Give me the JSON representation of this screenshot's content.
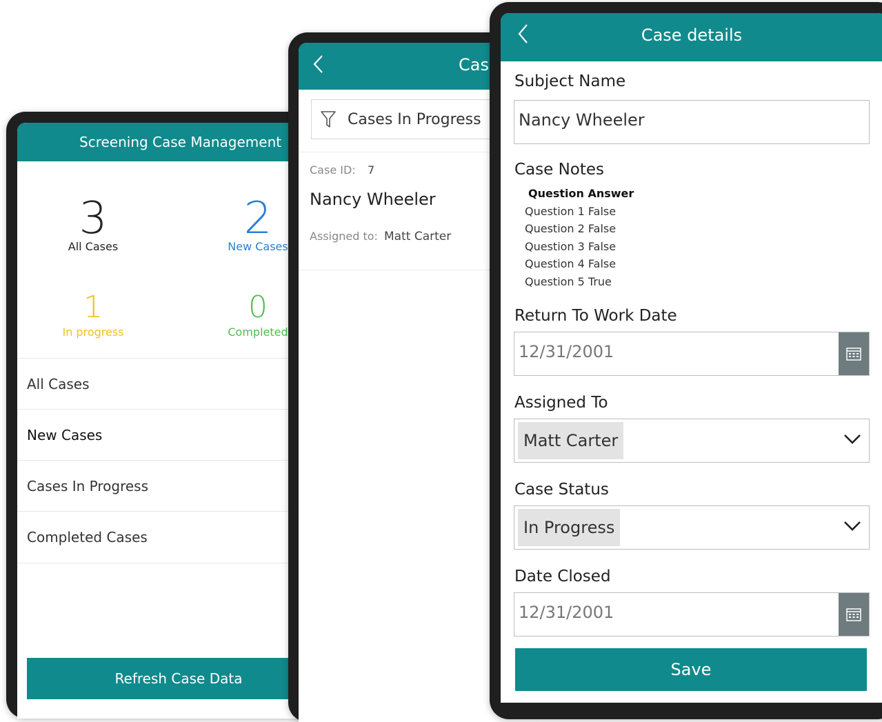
{
  "screen1": {
    "title": "Screening Case Management",
    "stats": [
      {
        "value": "3",
        "label": "All Cases",
        "color": "#222222"
      },
      {
        "value": "2",
        "label": "New Cases",
        "color": "#2a7fd4"
      },
      {
        "value": "1",
        "label": "In progress",
        "color": "#f2c11b"
      },
      {
        "value": "0",
        "label": "Completed",
        "color": "#4cbf4c"
      }
    ],
    "nav": [
      "All Cases",
      "New Cases",
      "Cases In Progress",
      "Completed Cases"
    ],
    "refresh_label": "Refresh Case Data"
  },
  "screen2": {
    "title": "Case",
    "filter_label": "Cases In Progress",
    "case": {
      "id_label": "Case ID:",
      "id_value": "7",
      "name": "Nancy Wheeler",
      "assigned_label": "Assigned to:",
      "assigned_value": "Matt Carter"
    }
  },
  "screen3": {
    "title": "Case details",
    "subject_label": "Subject Name",
    "subject_value": "Nancy Wheeler",
    "notes_label": "Case Notes",
    "notes_header": "Question Answer",
    "notes_lines": [
      "Question 1 False",
      "Question 2 False",
      "Question 3 False",
      "Question 4 False",
      "Question 5 True"
    ],
    "return_label": "Return To Work Date",
    "return_value": "12/31/2001",
    "assigned_label": "Assigned To",
    "assigned_value": "Matt Carter",
    "status_label": "Case Status",
    "status_value": "In Progress",
    "closed_label": "Date Closed",
    "closed_value": "12/31/2001",
    "save_label": "Save"
  },
  "colors": {
    "accent": "#108a8c"
  }
}
